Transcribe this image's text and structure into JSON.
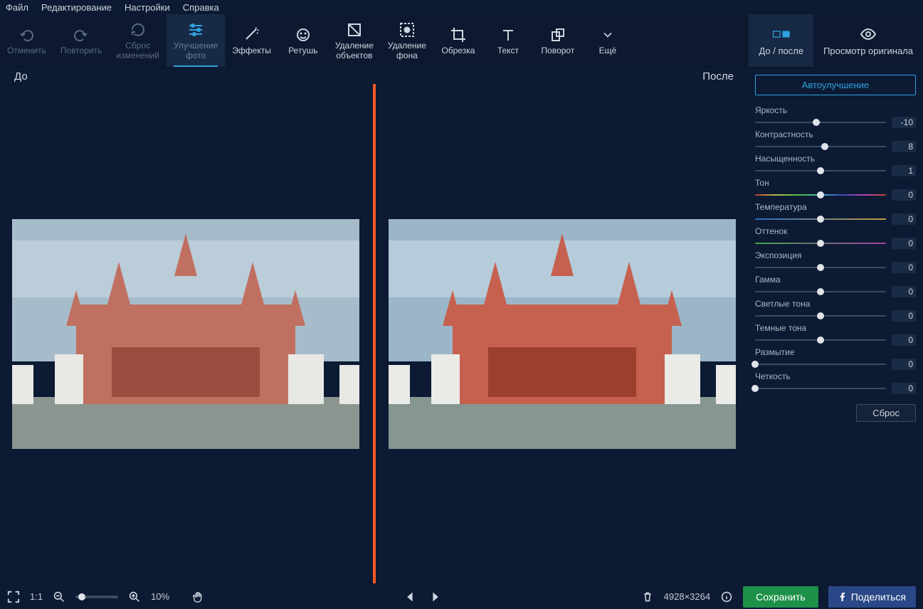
{
  "menu": {
    "file": "Файл",
    "edit": "Редактирование",
    "settings": "Настройки",
    "help": "Справка"
  },
  "toolbar": {
    "undo": "Отменить",
    "redo": "Повторить",
    "reset": "Сброс\nизменений",
    "enhance": "Улучшение\nфото",
    "effects": "Эффекты",
    "retouch": "Ретушь",
    "remove_obj": "Удаление\nобъектов",
    "remove_bg": "Удаление\nфона",
    "crop": "Обрезка",
    "text": "Текст",
    "rotate": "Поворот",
    "more": "Ещё",
    "before_after": "До / после",
    "view_original": "Просмотр\nоригинала"
  },
  "canvas": {
    "before": "До",
    "after": "После"
  },
  "sidebar": {
    "auto": "Автоулучшение",
    "reset": "Сброс",
    "sliders": [
      {
        "label": "Яркость",
        "value": "-10",
        "pos": 47,
        "active_from": 47,
        "active_to": 50
      },
      {
        "label": "Контрастность",
        "value": "8",
        "pos": 53,
        "active_from": 50,
        "active_to": 53
      },
      {
        "label": "Насыщенность",
        "value": "1",
        "pos": 50,
        "active_from": 50,
        "active_to": 50
      },
      {
        "label": "Тон",
        "value": "0",
        "pos": 50,
        "grad": "hue"
      },
      {
        "label": "Температура",
        "value": "0",
        "pos": 50,
        "grad": "temp"
      },
      {
        "label": "Оттенок",
        "value": "0",
        "pos": 50,
        "grad": "tint"
      },
      {
        "label": "Экспозиция",
        "value": "0",
        "pos": 50,
        "active_from": 50,
        "active_to": 50
      },
      {
        "label": "Гамма",
        "value": "0",
        "pos": 50,
        "active_from": 50,
        "active_to": 50
      },
      {
        "label": "Светлые тона",
        "value": "0",
        "pos": 50,
        "active_from": 50,
        "active_to": 50
      },
      {
        "label": "Темные тона",
        "value": "0",
        "pos": 50,
        "active_from": 50,
        "active_to": 50
      },
      {
        "label": "Размытие",
        "value": "0",
        "pos": 0,
        "active_from": 0,
        "active_to": 0
      },
      {
        "label": "Четкость",
        "value": "0",
        "pos": 0,
        "active_from": 0,
        "active_to": 0
      }
    ]
  },
  "status": {
    "fit": "1:1",
    "zoom": "10%",
    "dims": "4928×3264",
    "save": "Сохранить",
    "share": "Поделиться"
  }
}
